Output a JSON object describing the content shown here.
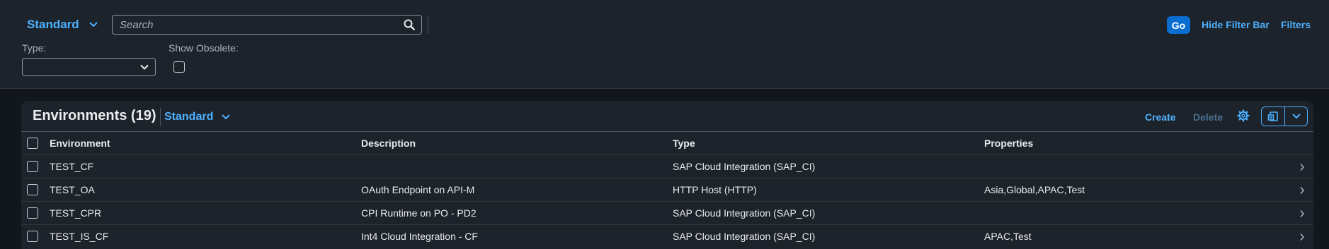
{
  "filterbar": {
    "variant_label": "Standard",
    "search_placeholder": "Search",
    "type_label": "Type:",
    "type_value": "",
    "obsolete_label": "Show Obsolete:",
    "go_label": "Go",
    "hide_label": "Hide Filter Bar",
    "filters_label": "Filters"
  },
  "table": {
    "title": "Environments (19)",
    "variant_label": "Standard",
    "create_label": "Create",
    "delete_label": "Delete",
    "columns": [
      "Environment",
      "Description",
      "Type",
      "Properties"
    ],
    "rows": [
      {
        "environment": "TEST_CF",
        "description": "",
        "type": "SAP Cloud Integration (SAP_CI)",
        "properties": ""
      },
      {
        "environment": "TEST_OA",
        "description": "OAuth Endpoint on API-M",
        "type": "HTTP Host (HTTP)",
        "properties": "Asia,Global,APAC,Test"
      },
      {
        "environment": "TEST_CPR",
        "description": "CPI Runtime on PO - PD2",
        "type": "SAP Cloud Integration (SAP_CI)",
        "properties": ""
      },
      {
        "environment": "TEST_IS_CF",
        "description": "Int4 Cloud Integration - CF",
        "type": "SAP Cloud Integration (SAP_CI)",
        "properties": "APAC,Test"
      }
    ]
  },
  "colors": {
    "accent": "#4db1ff",
    "emphasized": "#0a6ed1",
    "shell_bg": "#12171c",
    "panel_bg": "#1d232a"
  },
  "icons": {
    "variant_chevron": "chevron-down-icon",
    "search": "search-icon",
    "select_chevron": "chevron-down-icon",
    "settings": "gear-icon",
    "export": "export-spreadsheet-icon",
    "row_nav": "chevron-right-icon"
  }
}
